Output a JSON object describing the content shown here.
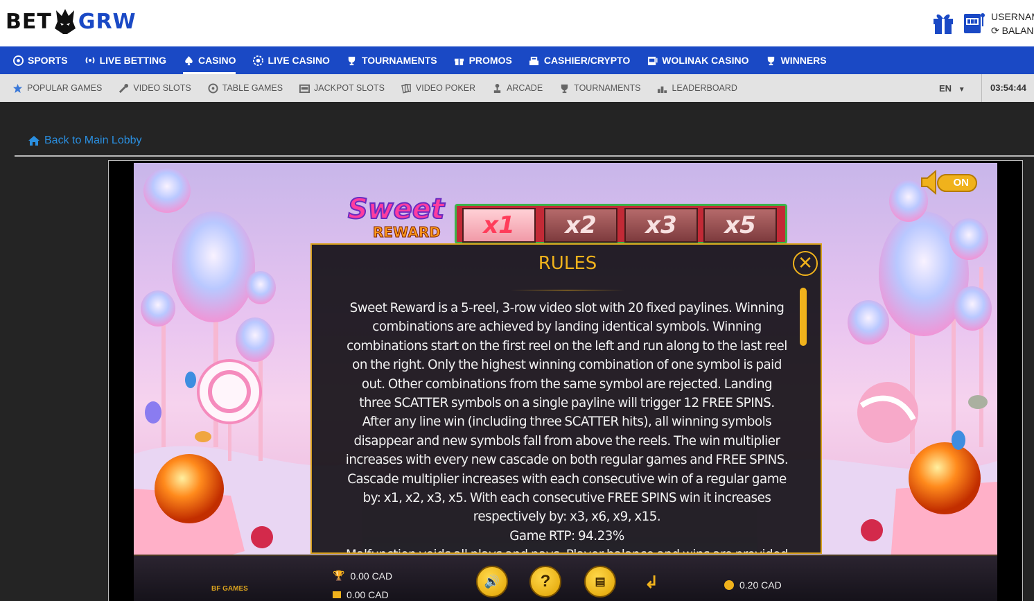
{
  "site": {
    "logo_left": "BET",
    "logo_right": "GRW"
  },
  "user": {
    "username_label": "USERNAM",
    "balance_label": "BALAN"
  },
  "main_nav": [
    {
      "label": "SPORTS",
      "icon": "soccer-ball-icon"
    },
    {
      "label": "LIVE BETTING",
      "icon": "broadcast-icon"
    },
    {
      "label": "CASINO",
      "icon": "spade-icon",
      "active": true
    },
    {
      "label": "LIVE CASINO",
      "icon": "chip-icon"
    },
    {
      "label": "TOURNAMENTS",
      "icon": "trophy-icon"
    },
    {
      "label": "PROMOS",
      "icon": "gift-icon"
    },
    {
      "label": "CASHIER/CRYPTO",
      "icon": "cashier-icon"
    },
    {
      "label": "WOLINAK CASINO",
      "icon": "slot-machine-icon"
    },
    {
      "label": "WINNERS",
      "icon": "trophy-icon"
    }
  ],
  "sub_nav": [
    {
      "label": "POPULAR GAMES",
      "icon": "star-icon"
    },
    {
      "label": "VIDEO SLOTS",
      "icon": "slot-lever-icon"
    },
    {
      "label": "TABLE GAMES",
      "icon": "roulette-icon"
    },
    {
      "label": "JACKPOT SLOTS",
      "icon": "jackpot-icon"
    },
    {
      "label": "VIDEO POKER",
      "icon": "cards-icon"
    },
    {
      "label": "ARCADE",
      "icon": "joystick-icon"
    },
    {
      "label": "TOURNAMENTS",
      "icon": "trophy-icon"
    },
    {
      "label": "LEADERBOARD",
      "icon": "podium-icon"
    }
  ],
  "language": "EN",
  "clock": "03:54:44",
  "back_link": "Back to Main Lobby",
  "game": {
    "sound_label": "ON",
    "logo_line1": "Sweet",
    "logo_line2": "REWARD",
    "multipliers": [
      "x1",
      "x2",
      "x3",
      "x5"
    ],
    "win": "0.00 CAD",
    "balance": "0.00 CAD",
    "bet": "0.20 CAD",
    "provider": "BF GAMES"
  },
  "rules": {
    "title": "RULES",
    "text": "Sweet Reward is a 5-reel, 3-row video slot with 20 fixed paylines. Winning combinations are achieved by landing identical symbols. Winning combinations start on the first reel on the left and run along to the last reel on the right. Only the highest winning combination of one symbol is paid out. Other combinations from the same symbol are rejected. Landing three SCATTER symbols on a single payline will trigger 12 FREE SPINS. After any line win (including three SCATTER hits), all winning symbols disappear and new symbols fall from above the reels. The win multiplier increases with every new cascade on both regular games and FREE SPINS. Cascade multiplier increases with each consecutive win of a regular game by: x1, x2, x3, x5. With each consecutive FREE SPINS win it increases respectively by: x3, x6, x9, x15.",
    "rtp": "Game RTP: 94.23%",
    "malfunction": "Malfunction voids all plays and pays. Player balance and wins are provided in"
  },
  "colors": {
    "brand_blue": "#1a49c5",
    "gold": "#f0b21c",
    "link_blue": "#2a8fe0"
  }
}
